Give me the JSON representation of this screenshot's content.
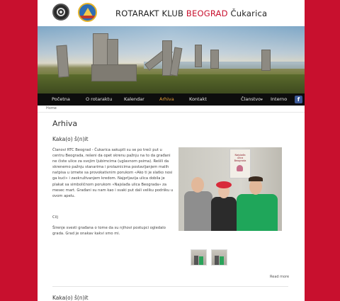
{
  "header": {
    "site_title_prefix": "ROTARAKT KLUB ",
    "site_title_highlight": "BEOGRAD",
    "site_title_suffix": " Čukarica"
  },
  "nav": {
    "items": [
      {
        "label": "Početna"
      },
      {
        "label": "O rotaraktu"
      },
      {
        "label": "Kalendar"
      },
      {
        "label": "Arhiva",
        "active": true
      },
      {
        "label": "Kontakt"
      },
      {
        "label": "Članstvo"
      },
      {
        "label": "Interno"
      }
    ],
    "dropdown_caret": "▾",
    "facebook_icon": "f"
  },
  "breadcrumb": {
    "home": "Home"
  },
  "main": {
    "page_title": "Arhiva",
    "article": {
      "title": "Kaka(o) š(n)it",
      "paragraph1": "Članovi RTC Beograd - Čukarica sakupili su se po treći put u centru Beograda, rešeni da opet skrenu pažnju na to da građani ne čiste ulice za svojim ljubimcima (uglavnom psima). Rešili da skrenemo pažnju stanarima i prolaznicima postavljanjem malih natpisa u izmete sa provokativnim porukom «Ako ti je slatko nosi ga kući» i zaokruživanjem kredom. Najprljavija ulica dobila je plakat sa simboličnom porukom «Najslađa ulica Beograda» za mesec mart. Građani su nam kao i svaki put dali veliku podršku u ovom apelu.",
      "paragraph2": "Cilj",
      "paragraph3": "Širenje svesti građana o tome da su njihovi postupci ogledalo grada. Grad je onakav kakvi smo mi.",
      "photo_sign_text": "Najslađa ulica Beograda",
      "read_more": "Read more"
    },
    "article2": {
      "title": "Kaka(o) š(n)it"
    }
  },
  "colors": {
    "background": "#c8102e",
    "accent": "#c8102e",
    "nav_active": "#e8a33a",
    "nav_bg": "#0d0d0d",
    "facebook": "#3b5998"
  }
}
